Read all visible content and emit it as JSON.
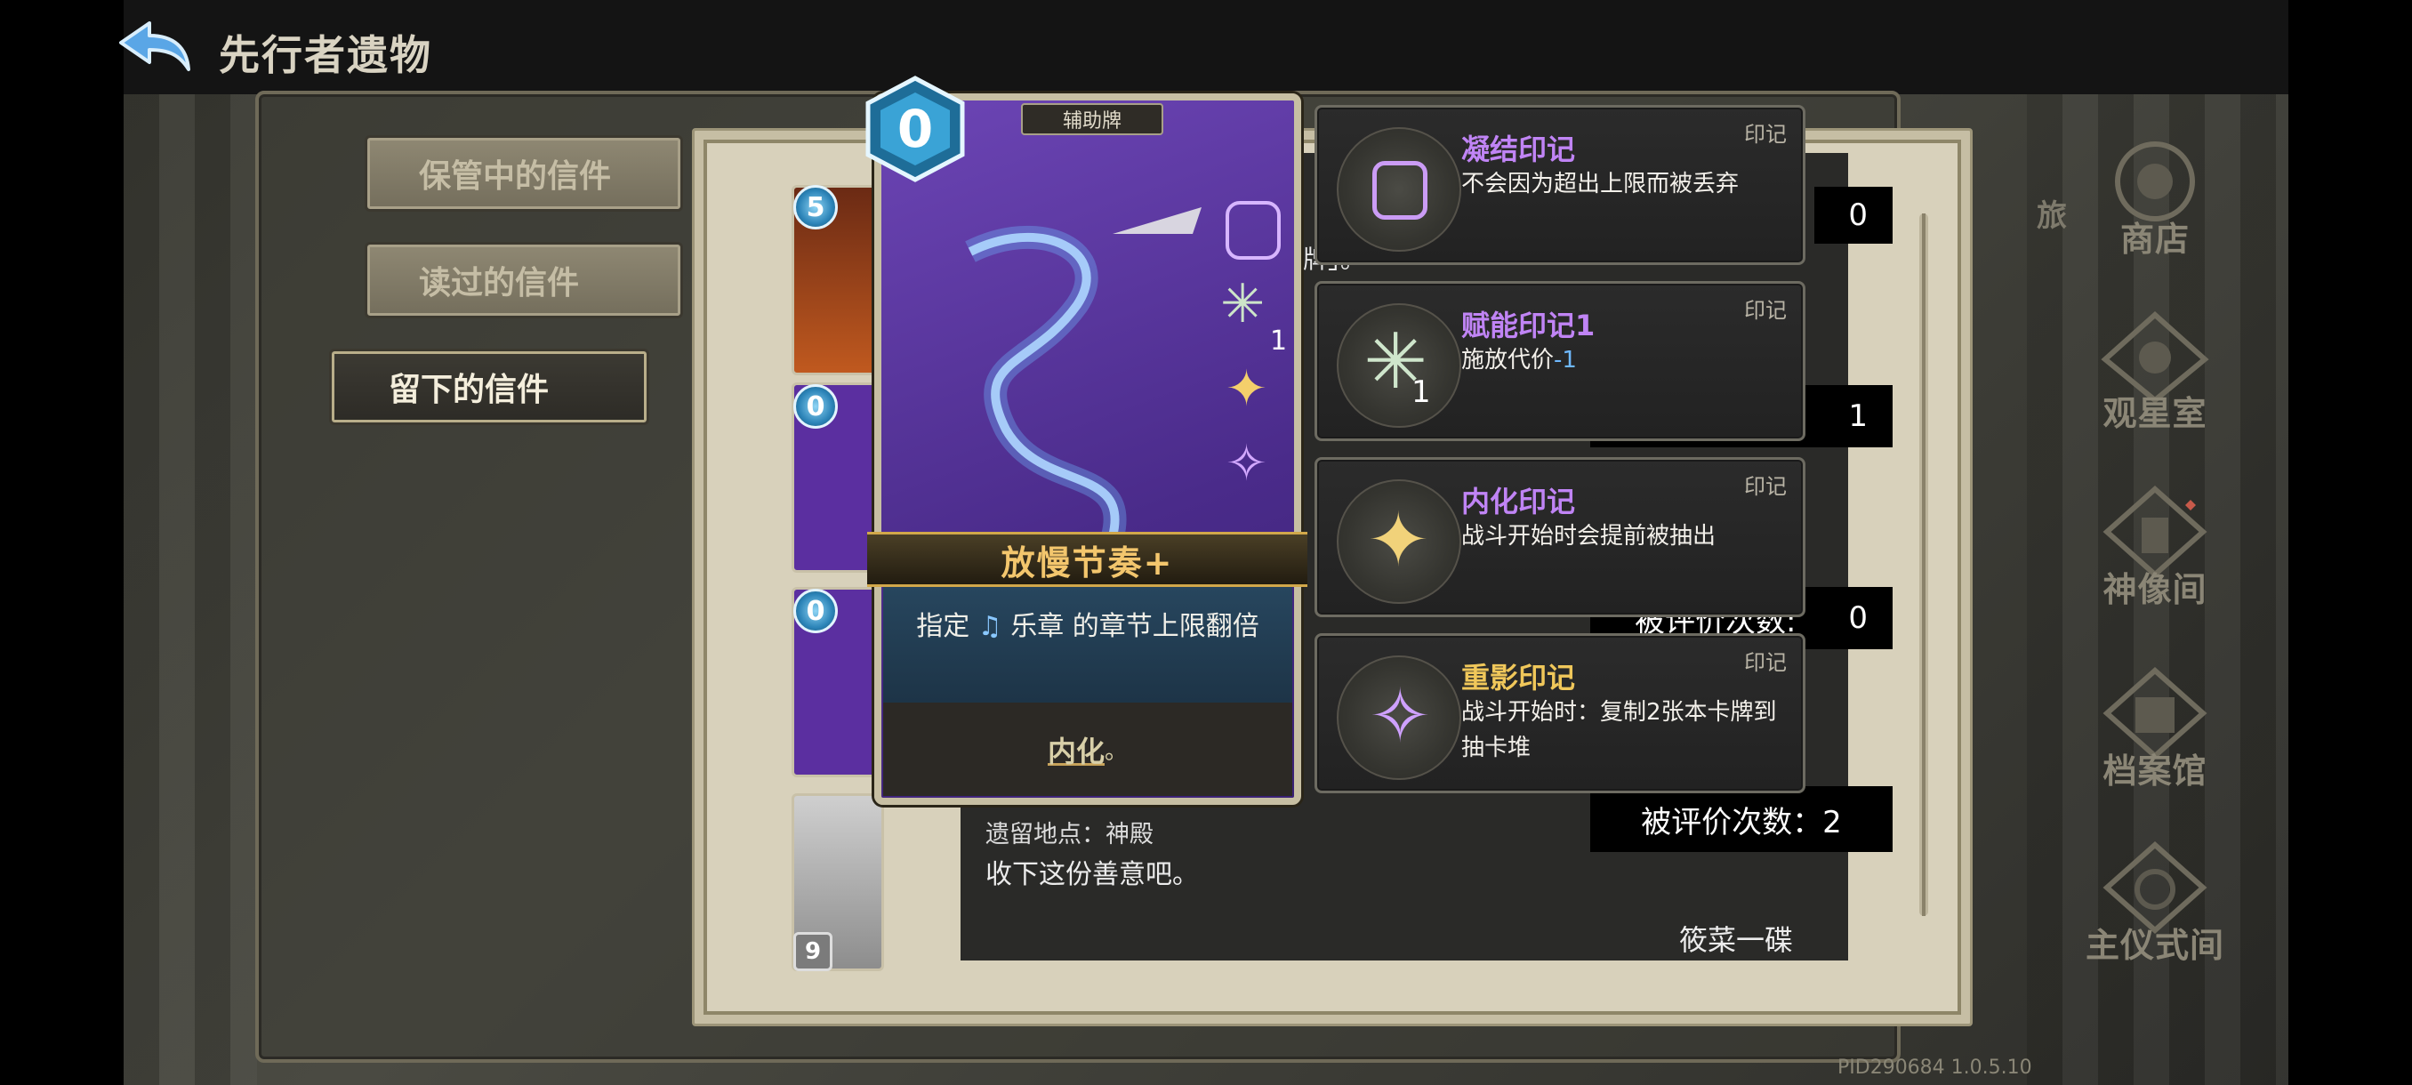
{
  "header": {
    "title": "先行者遗物"
  },
  "tabs": [
    {
      "label": "保管中的信件"
    },
    {
      "label": "读过的信件"
    },
    {
      "label": "留下的信件"
    }
  ],
  "thumbnails": [
    {
      "cost": "5"
    },
    {
      "cost": "0"
    },
    {
      "cost": "0"
    },
    {
      "cost": "9"
    }
  ],
  "card": {
    "cost": "0",
    "type": "辅助牌",
    "name": "放慢节奏+",
    "desc_pre": "指定",
    "desc_post": "乐章 的章节上限翻倍",
    "keyword": "内化",
    "keyword_suffix": "。",
    "side_mark_count": "1"
  },
  "seals": [
    {
      "tag": "印记",
      "name": "凝结印记",
      "desc": "不会因为超出上限而被丢弃",
      "name_color": "#c084f5"
    },
    {
      "tag": "印记",
      "name": "赋能印记1",
      "desc_pre": "施放代价",
      "desc_hl": "-1",
      "count": "1",
      "name_color": "#c084f5"
    },
    {
      "tag": "印记",
      "name": "内化印记",
      "desc": "战斗开始时会提前被抽出",
      "name_color": "#c084f5"
    },
    {
      "tag": "印记",
      "name": "重影印记",
      "desc": "战斗开始时：复制2张本卡牌到抽卡堆",
      "name_color": "#f0c75a"
    }
  ],
  "letter": {
    "peek_text": "牌」。",
    "ratings": [
      "0",
      "1",
      "0"
    ],
    "rating_partial_label": "被评价次数:",
    "rating_full": "被评价次数：2",
    "location": "遗留地点：神殿",
    "message": "收下这份善意吧。",
    "signature": "筱菜一碟",
    "side_peek": "旅"
  },
  "nav": [
    {
      "label": "商店"
    },
    {
      "label": "观星室"
    },
    {
      "label": "神像间"
    },
    {
      "label": "档案馆"
    },
    {
      "label": "主仪式间"
    }
  ],
  "version": "PID290684  1.0.5.10"
}
